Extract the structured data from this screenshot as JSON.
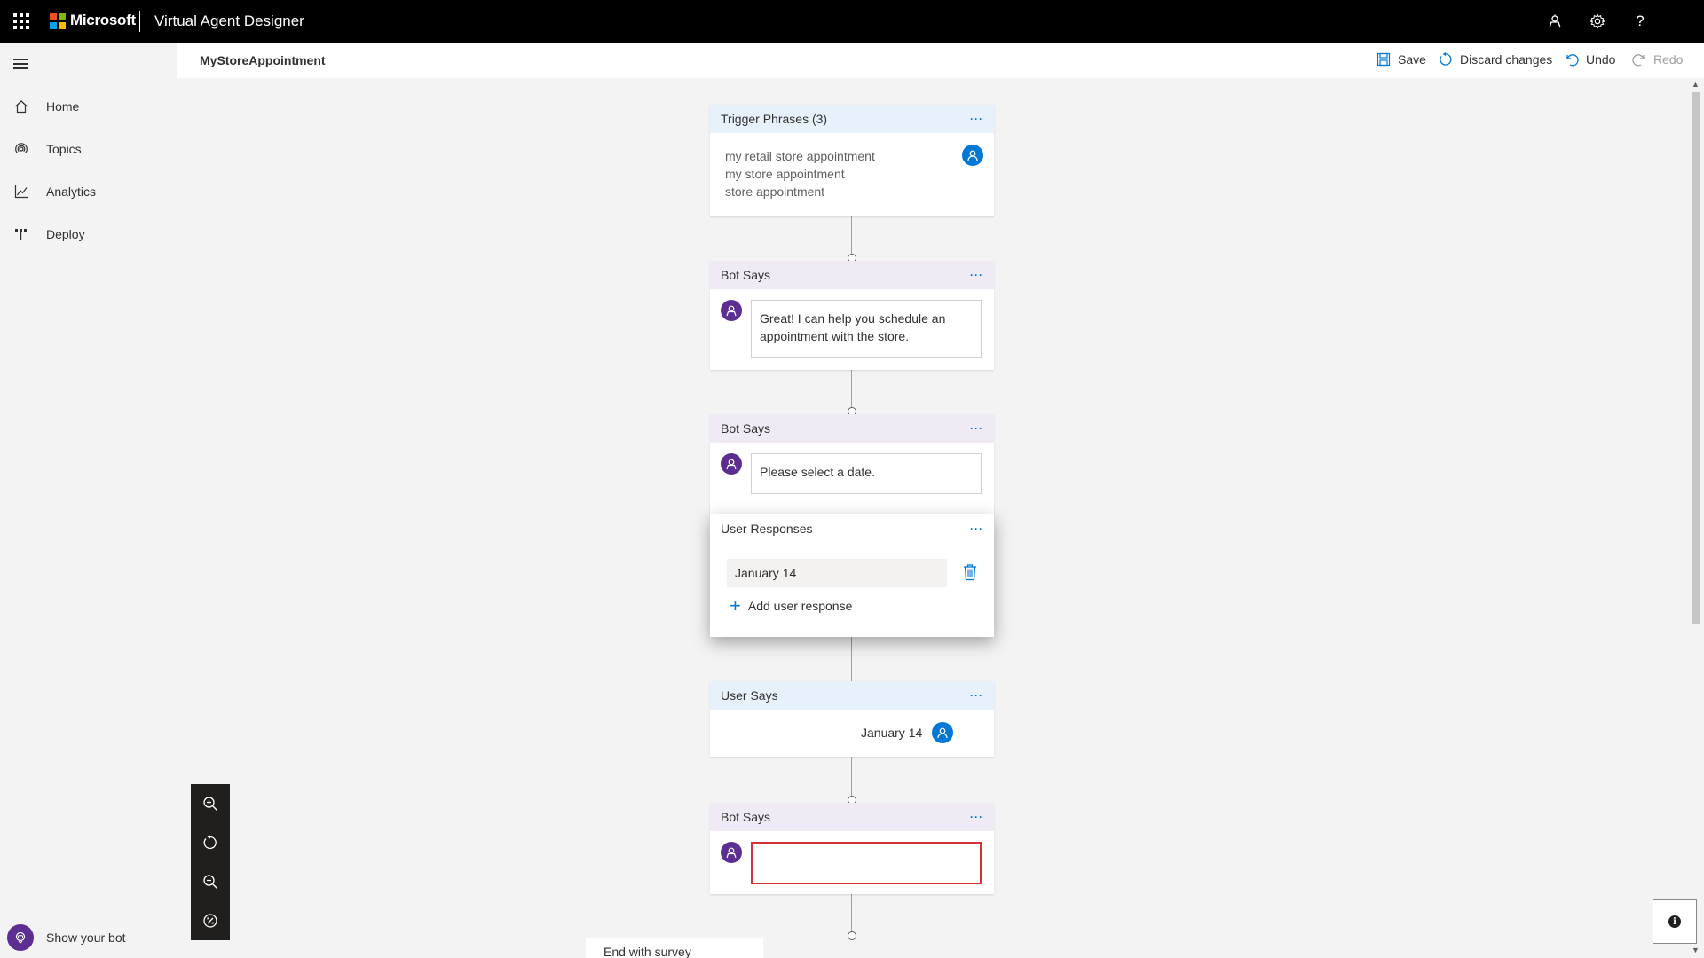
{
  "header": {
    "brand": "Microsoft",
    "app_title": "Virtual Agent Designer",
    "logo_colors": [
      "#f25022",
      "#7fba00",
      "#00a4ef",
      "#ffb900"
    ],
    "icons": [
      "waffle-icon",
      "bot-person-icon",
      "settings-gear-icon",
      "help-icon"
    ],
    "help_label": "?"
  },
  "sidebar": {
    "items": [
      {
        "label": "Home",
        "icon": "home-icon"
      },
      {
        "label": "Topics",
        "icon": "topics-icon"
      },
      {
        "label": "Analytics",
        "icon": "analytics-icon"
      },
      {
        "label": "Deploy",
        "icon": "deploy-icon"
      }
    ],
    "show_bot_label": "Show your bot"
  },
  "commandbar": {
    "topic_name": "MyStoreAppointment",
    "save_label": "Save",
    "discard_label": "Discard changes",
    "undo_label": "Undo",
    "redo_label": "Redo"
  },
  "canvas": {
    "trigger": {
      "title": "Trigger Phrases (3)",
      "phrases": [
        "my retail store appointment",
        "my store appointment",
        "store appointment"
      ]
    },
    "bot_says_1": {
      "title": "Bot Says",
      "message": "Great! I can help you schedule an appointment with the store."
    },
    "bot_says_2": {
      "title": "Bot Says",
      "message": "Please select a date."
    },
    "user_responses": {
      "title": "User Responses",
      "value": "January 14",
      "add_label": "Add user response"
    },
    "user_says": {
      "title": "User Says",
      "value": "January 14"
    },
    "bot_says_3": {
      "title": "Bot Says",
      "message": ""
    },
    "end": {
      "label": "End with survey"
    },
    "menu_glyph": "···"
  },
  "colors": {
    "accent": "#0078d4",
    "bot_purple": "#5c2e91",
    "error": "#d13438"
  }
}
